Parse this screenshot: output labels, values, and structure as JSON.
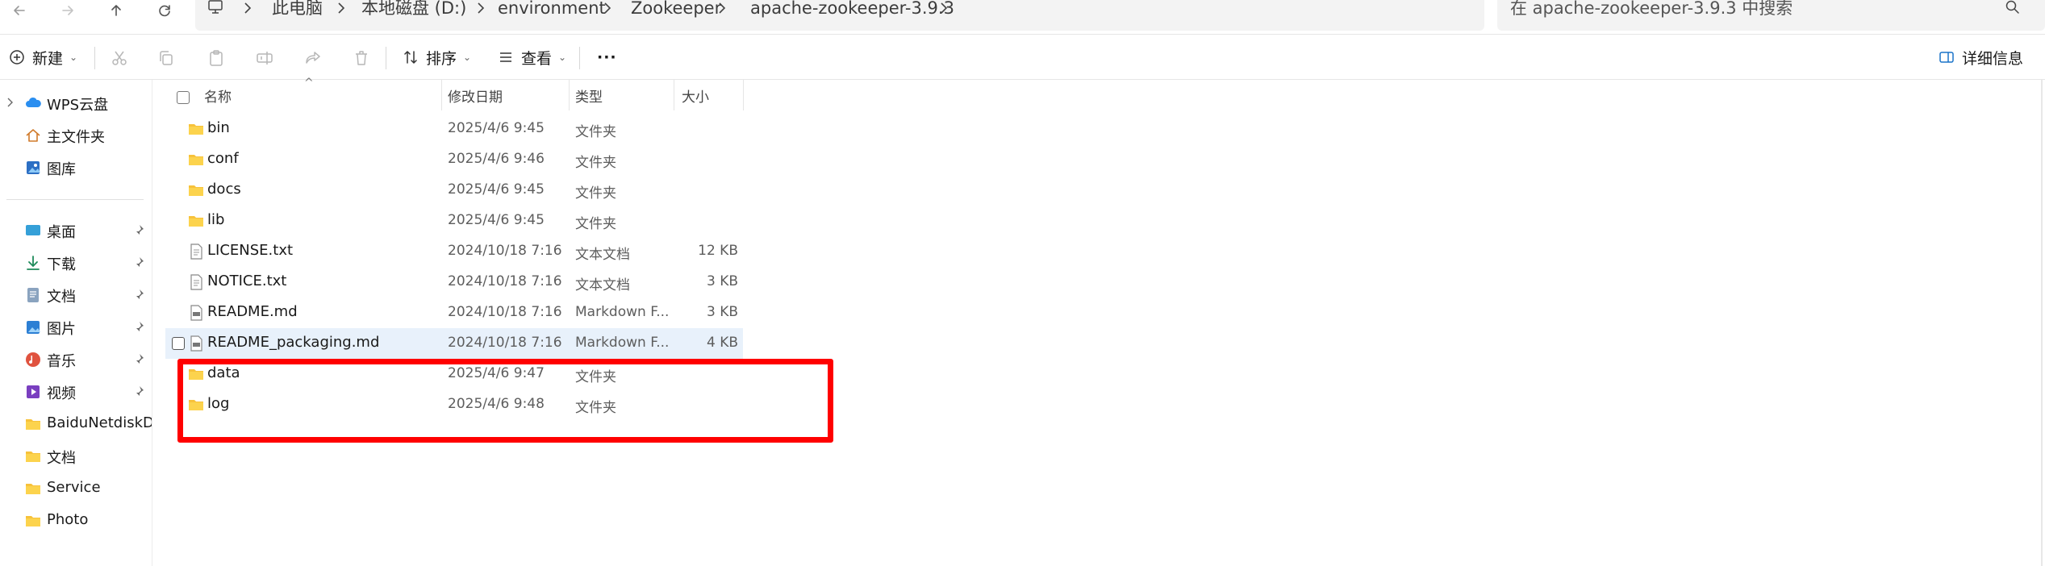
{
  "nav": {
    "back": "back-arrow",
    "forward": "forward-arrow",
    "up": "up-arrow",
    "refresh": "refresh"
  },
  "breadcrumb": [
    "此电脑",
    "本地磁盘 (D:)",
    "environment",
    "Zookeeper",
    "apache-zookeeper-3.9.3"
  ],
  "search": {
    "placeholder": "在 apache-zookeeper-3.9.3 中搜索"
  },
  "toolbar": {
    "new_label": "新建",
    "sort_label": "排序",
    "view_label": "查看",
    "more_label": "···",
    "details_label": "详细信息"
  },
  "sidebar": {
    "top_items": [
      {
        "label": "WPS云盘",
        "icon": "cloud-icon"
      },
      {
        "label": "主文件夹",
        "icon": "home-icon"
      },
      {
        "label": "图库",
        "icon": "gallery-icon"
      }
    ],
    "pinned_items": [
      {
        "label": "桌面",
        "icon": "desktop-icon"
      },
      {
        "label": "下载",
        "icon": "download-icon"
      },
      {
        "label": "文档",
        "icon": "document-icon"
      },
      {
        "label": "图片",
        "icon": "pictures-icon"
      },
      {
        "label": "音乐",
        "icon": "music-icon"
      },
      {
        "label": "视频",
        "icon": "video-icon"
      }
    ],
    "folders": [
      {
        "label": "BaiduNetdiskDownload"
      },
      {
        "label": "文档"
      },
      {
        "label": "Service"
      },
      {
        "label": "Photo"
      }
    ]
  },
  "columns": {
    "name": "名称",
    "modified": "修改日期",
    "type": "类型",
    "size": "大小"
  },
  "files": [
    {
      "name": "bin",
      "modified": "2025/4/6 9:45",
      "type": "文件夹",
      "size": "",
      "icon": "folder-icon"
    },
    {
      "name": "conf",
      "modified": "2025/4/6 9:46",
      "type": "文件夹",
      "size": "",
      "icon": "folder-icon"
    },
    {
      "name": "docs",
      "modified": "2025/4/6 9:45",
      "type": "文件夹",
      "size": "",
      "icon": "folder-icon"
    },
    {
      "name": "lib",
      "modified": "2025/4/6 9:45",
      "type": "文件夹",
      "size": "",
      "icon": "folder-icon"
    },
    {
      "name": "LICENSE.txt",
      "modified": "2024/10/18 7:16",
      "type": "文本文档",
      "size": "12 KB",
      "icon": "text-file-icon"
    },
    {
      "name": "NOTICE.txt",
      "modified": "2024/10/18 7:16",
      "type": "文本文档",
      "size": "3 KB",
      "icon": "text-file-icon"
    },
    {
      "name": "README.md",
      "modified": "2024/10/18 7:16",
      "type": "Markdown F...",
      "size": "3 KB",
      "icon": "markdown-file-icon"
    },
    {
      "name": "README_packaging.md",
      "modified": "2024/10/18 7:16",
      "type": "Markdown F...",
      "size": "4 KB",
      "icon": "markdown-file-icon"
    },
    {
      "name": "data",
      "modified": "2025/4/6 9:47",
      "type": "文件夹",
      "size": "",
      "icon": "folder-icon"
    },
    {
      "name": "log",
      "modified": "2025/4/6 9:48",
      "type": "文件夹",
      "size": "",
      "icon": "folder-icon"
    }
  ],
  "colors": {
    "highlight": "#ff0000",
    "folder": "#f7c23b",
    "selection": "#e8f1fb",
    "accent": "#1a73c9"
  }
}
